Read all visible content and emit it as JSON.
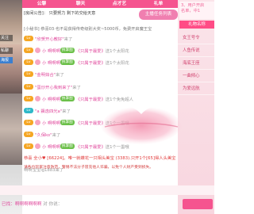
{
  "tabs": [
    {
      "label": "公聊"
    },
    {
      "label": "聊天"
    },
    {
      "label": "点才艺"
    },
    {
      "label": "礼单"
    }
  ],
  "notices": {
    "public": "[房间公告]： 只要努力 剩下的交给天意",
    "secretary": "[小秘书] 恭喜03·也不是获得传奇级别大奖~5000币，免费开启魔王宝"
  },
  "live_button": "主播任务列表",
  "side_buttons": [
    "关注",
    "私聊",
    "海报"
  ],
  "right_panel": {
    "banner_line1": "3、用户开启",
    "banner_line2": "名单，中1",
    "gift_title": "礼物名称",
    "gifts": [
      "女王号令",
      "人鱼传说",
      "海底王座",
      "一曲倾心",
      "为爱远航"
    ]
  },
  "chat": [
    {
      "badge": "Lv",
      "name": "\"欣贺开心教好\"",
      "action": "来了"
    },
    {
      "badge": "Lv",
      "name": "小 啊啊啊",
      "action": "执掌图",
      "tag": "《只属于最爱》",
      "detail": "送1个太阳花"
    },
    {
      "badge": "Lv",
      "name": "小 啊啊啊",
      "action": "执掌图",
      "tag": "《只属于最爱》",
      "detail": "送1个太阳花"
    },
    {
      "badge": "Lv",
      "name": "\"金明茹合\"",
      "action": "来了"
    },
    {
      "badge": "Lv",
      "name": "\"蛋炒开心我到来了\"",
      "action": "来了"
    },
    {
      "badge": "Lv",
      "name": "小 啊啊啊",
      "action": "执掌图",
      "tag": "《只属于最爱》",
      "detail": "送1个免免超人"
    },
    {
      "badge": "Lv",
      "name": "\"a 飘逸四光a\"",
      "action": "来了"
    },
    {
      "badge": "Lv",
      "name": "小 啊啊啊",
      "action": "执掌图",
      "tag": "《只属于最爱》",
      "detail": "送1个一墨哦"
    },
    {
      "badge": "Lv",
      "name": "\"久保ko\"",
      "action": "来了"
    },
    {
      "badge": "Lv",
      "name": "小 啊啊啊",
      "action": "执掌图",
      "tag": "《只属于最爱》",
      "detail": "送1个一墨哦"
    }
  ],
  "special_msg": "恭喜 全小♥ [66224]。唯一就蝶花一只相头美宝 (3383).只开1个[65]得人头美宝 !",
  "last_msg": "啊啊宝宝ig1883来了",
  "system_notice": "请各位玩家注意防范，警惕不法分子冒充他人诈骗，以免个人财产受到损失。",
  "bottom": {
    "user": "已找：啊啊啊啊啊啊",
    "hint": "对 你说："
  },
  "colors": {
    "accent": "#f5548f",
    "name_pink": "#e0489c",
    "name_blue": "#3b7de0",
    "level_badge": "#f5a623"
  }
}
